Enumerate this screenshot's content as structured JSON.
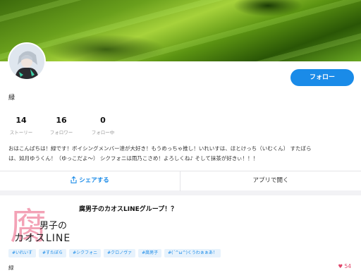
{
  "profile": {
    "name": "緑",
    "follow_label": "フォロー",
    "stats": [
      {
        "value": "14",
        "label": "ストーリー"
      },
      {
        "value": "16",
        "label": "フォロワー"
      },
      {
        "value": "0",
        "label": "フォロー中"
      }
    ],
    "bio_line1": "おはこんばちは！緑です！ボイシングメンバー達が大好き！もうめっちゃ推し！いれいすは、ほとけっち（いむくん） すたぼら",
    "bio_line2": "は、如月ゆうくん！（ゆっこだよ〜） シクフォニは雨乃こさめ！よろしくね♪ そして抹茶が好きぃ！！！"
  },
  "actions": {
    "share_label": "シェアする",
    "open_app_label": "アプリで開く"
  },
  "story": {
    "title": "腐男子のカオスLINEグループ！？",
    "thumbnail": {
      "kanji": "腐",
      "text1": "男子の",
      "text2": "カオスLINE"
    },
    "tags": [
      "#いれいす",
      "#すたぼら",
      "#シクフォニ",
      "#クロノヴァ",
      "#腐男子",
      "#(´^ω^)くうわぁぁあ！"
    ],
    "author": "緑",
    "likes": "54"
  },
  "colors": {
    "accent": "#1a8be8",
    "like": "#e0456a",
    "tag_bg": "#e7f2fc"
  }
}
